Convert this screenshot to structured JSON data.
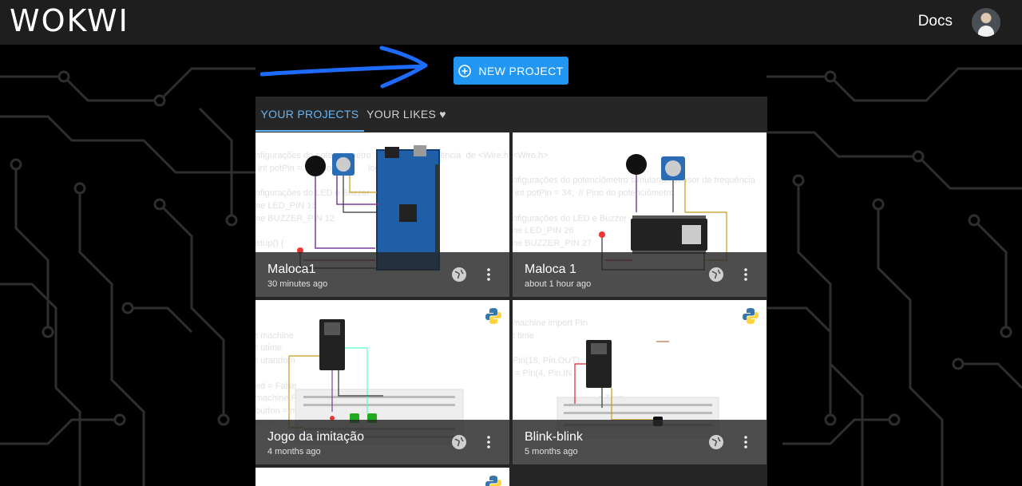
{
  "app": {
    "logo_text": "WOKWI",
    "docs_label": "Docs"
  },
  "actions": {
    "new_project_label": "NEW PROJECT"
  },
  "tabs": [
    {
      "label": "YOUR PROJECTS",
      "active": true
    },
    {
      "label": "YOUR LIKES ♥",
      "active": false
    }
  ],
  "projects": [
    {
      "title": "Maloca1",
      "time": "30 minutes ago",
      "language": "arduino",
      "code_preview": "nfigurações do potenciômetro         sor de frequência  de <Wire.h>\n int potPin =        do pot         lógico A0)\n\nnfigurações do LED e Buzzer\nne LED_PIN 13\nne BUZZER_PIN 12\n\netup() {"
    },
    {
      "title": "Maloca 1",
      "time": "about 1 hour ago",
      "language": "arduino",
      "code_preview": "<Wire.h>\n\nnfigurações do potenciômetro simulando sensor de frequência\n int potPin = 34;  // Pino do potenciômetro\n\nnfigurações do LED e Buzzer\nne LED_PIN 26\nne BUZZER_PIN 27"
    },
    {
      "title": "Jogo da imitação",
      "time": "4 months ago",
      "language": "python",
      "code_preview": "\nt machine\nt utime\nt urandom\n\ned = False\nmachine.Pin(1     machine.Pin.OUT)\nbutton = m                              PULL_DOWN\nbutton =                               PULL_DOWN"
    },
    {
      "title": "Blink-blink",
      "time": "5 months ago",
      "language": "python",
      "code_preview": "machine import Pin\nt time\n\nPin(18, Pin.OUT)\n = Pin(4, Pin.IN\n\n                                   e True:\n                                   utton.value"
    }
  ],
  "colors": {
    "topbar": "#1e1e1e",
    "accent": "#2196f3",
    "tab_active": "#64b5f6",
    "panel": "#262626"
  },
  "icons": {
    "new_project": "plus-circle-icon",
    "visibility": "globe-icon",
    "menu": "more-vert-icon",
    "language": "python-icon"
  }
}
